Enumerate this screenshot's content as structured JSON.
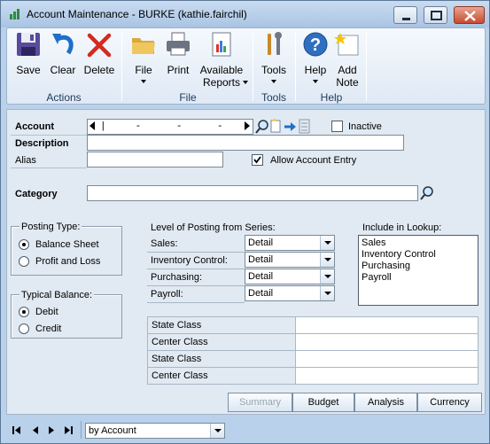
{
  "window": {
    "title": "Account Maintenance  -  BURKE (kathie.fairchil)"
  },
  "ribbon": {
    "groups": {
      "actions": "Actions",
      "file": "File",
      "tools": "Tools",
      "help": "Help"
    },
    "buttons": {
      "save": "Save",
      "clear": "Clear",
      "delete": "Delete",
      "file": "File",
      "print": "Print",
      "available_reports_1": "Available",
      "available_reports_2": "Reports",
      "tools": "Tools",
      "help": "Help",
      "add_note_1": "Add",
      "add_note_2": "Note"
    }
  },
  "form": {
    "account_label": "Account",
    "account_value": "|     -      -      -",
    "inactive_label": "Inactive",
    "inactive_checked": false,
    "description_label": "Description",
    "description_value": "",
    "alias_label": "Alias",
    "alias_value": "",
    "allow_entry_label": "Allow Account Entry",
    "allow_entry_checked": true,
    "category_label": "Category",
    "category_value": ""
  },
  "posting_type": {
    "title": "Posting Type:",
    "options": [
      "Balance Sheet",
      "Profit and Loss"
    ],
    "selected": "Balance Sheet"
  },
  "typical_balance": {
    "title": "Typical Balance:",
    "options": [
      "Debit",
      "Credit"
    ],
    "selected": "Debit"
  },
  "level_of_posting": {
    "title": "Level of Posting from Series:",
    "rows": [
      {
        "label": "Sales:",
        "value": "Detail"
      },
      {
        "label": "Inventory Control:",
        "value": "Detail"
      },
      {
        "label": "Purchasing:",
        "value": "Detail"
      },
      {
        "label": "Payroll:",
        "value": "Detail"
      }
    ]
  },
  "include_lookup": {
    "title": "Include in Lookup:",
    "items": [
      "Sales",
      "Inventory Control",
      "Purchasing",
      "Payroll"
    ]
  },
  "classes": {
    "rows": [
      {
        "label": "State Class",
        "value": ""
      },
      {
        "label": "Center Class",
        "value": ""
      },
      {
        "label": "State Class",
        "value": ""
      },
      {
        "label": "Center Class",
        "value": ""
      }
    ]
  },
  "actions": {
    "summary": "Summary",
    "budget": "Budget",
    "analysis": "Analysis",
    "currency": "Currency"
  },
  "sort": {
    "value": "by Account"
  },
  "colors": {
    "frame": "#b9d1ea",
    "form_bg": "#e1e9f2",
    "accent_blue": "#2f6fc1"
  }
}
